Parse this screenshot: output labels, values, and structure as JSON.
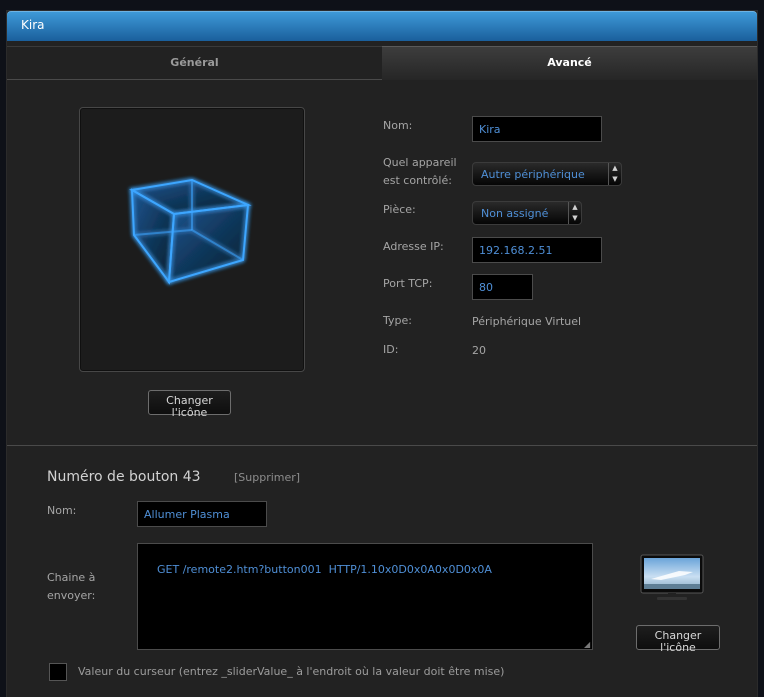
{
  "window": {
    "title": "Kira"
  },
  "tabs": [
    {
      "label": "Général",
      "active": false
    },
    {
      "label": "Avancé",
      "active": true
    }
  ],
  "device": {
    "icon": "wireframe-cube-icon",
    "change_icon_label_line1": "Changer",
    "change_icon_label_line2": "l'icône",
    "fields": {
      "name": {
        "label": "Nom:",
        "value": "Kira"
      },
      "controlled_device": {
        "label_line1": "Quel appareil",
        "label_line2": "est contrôlé:",
        "value": "Autre périphérique"
      },
      "room": {
        "label": "Pièce:",
        "value": "Non assigné"
      },
      "ip": {
        "label": "Adresse IP:",
        "value": "192.168.2.51"
      },
      "port": {
        "label": "Port TCP:",
        "value": "80"
      },
      "type": {
        "label": "Type:",
        "value": "Périphérique Virtuel"
      },
      "id": {
        "label": "ID:",
        "value": "20"
      }
    }
  },
  "button_section": {
    "title": "Numéro de bouton 43",
    "delete_label": "[Supprimer]",
    "name": {
      "label": "Nom:",
      "value": "Allumer Plasma"
    },
    "command": {
      "label_line1": "Chaine à",
      "label_line2": "envoyer:",
      "value": "GET /remote2.htm?button001  HTTP/1.10x0D0x0A0x0D0x0A"
    },
    "icon": "tv-icon",
    "change_icon_label_line1": "Changer",
    "change_icon_label_line2": "l'icône",
    "slider_checkbox": {
      "checked": false,
      "label": "Valeur du curseur (entrez _sliderValue_ à l'endroit où la valeur doit être mise)"
    }
  },
  "colors": {
    "titlebar_top": "#3f9bd9",
    "titlebar_bottom": "#1a5f9c",
    "input_text": "#4f8fd6",
    "panel": "#222222"
  }
}
